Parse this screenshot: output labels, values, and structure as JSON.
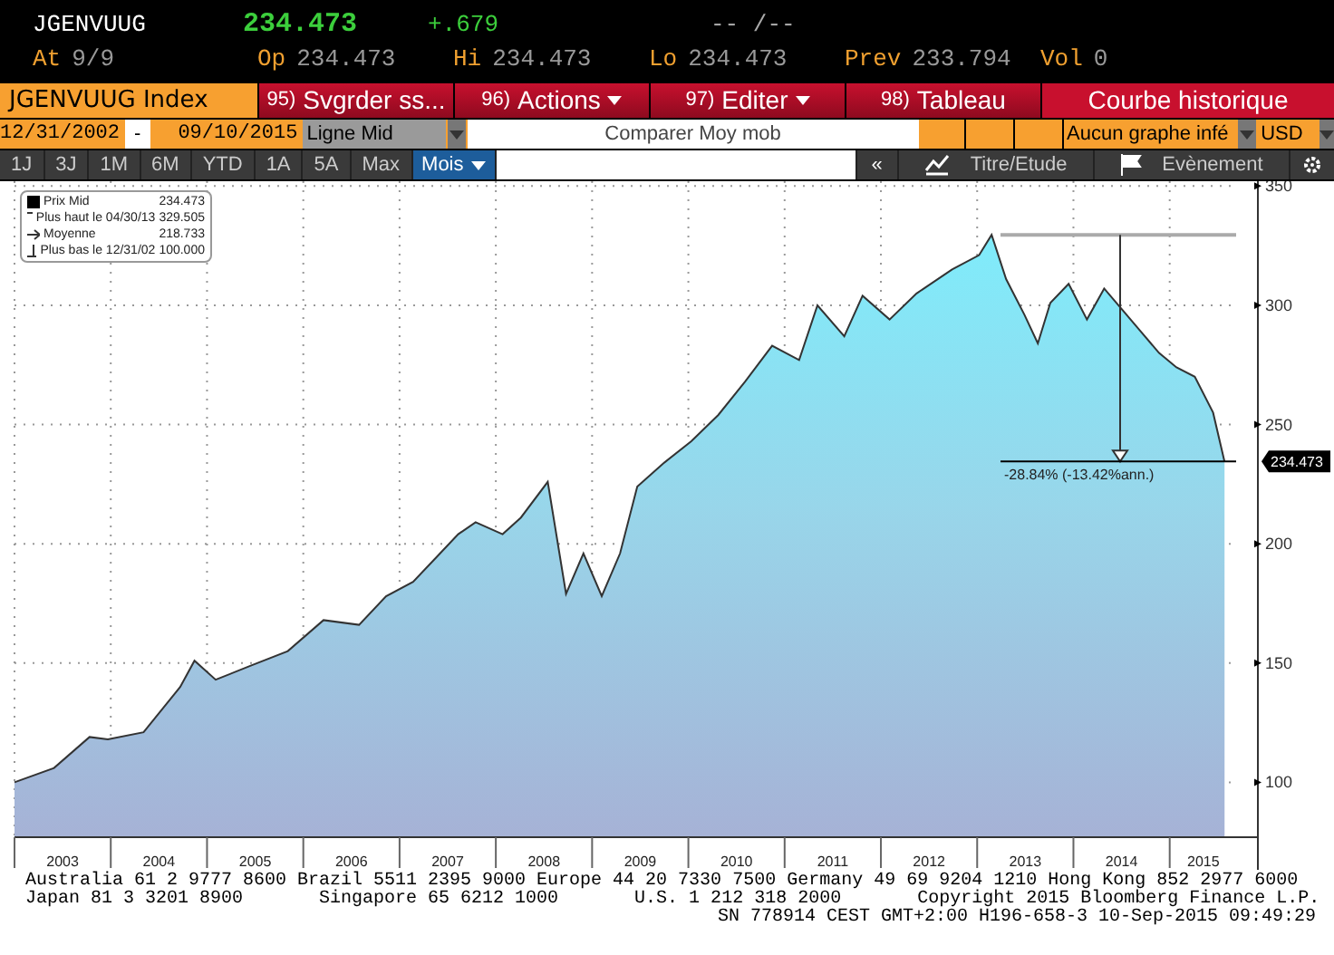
{
  "quote": {
    "ticker": "JGENVUUG",
    "last": "234.473",
    "change": "+.679",
    "time_range": "-- /--"
  },
  "stats": [
    {
      "label": "At",
      "value": "9/9"
    },
    {
      "label": "Op",
      "value": "234.473"
    },
    {
      "label": "Hi",
      "value": "234.473"
    },
    {
      "label": "Lo",
      "value": "234.473"
    },
    {
      "label": "Prev",
      "value": "233.794"
    },
    {
      "label": "Vol",
      "value": "0"
    }
  ],
  "toolbar": {
    "security": "JGENVUUG Index",
    "menus": [
      {
        "number": "95)",
        "label": "Svgrder ss...",
        "dropdown": false
      },
      {
        "number": "96)",
        "label": "Actions",
        "dropdown": true
      },
      {
        "number": "97)",
        "label": "Editer",
        "dropdown": true
      },
      {
        "number": "98)",
        "label": "Tableau",
        "dropdown": false
      }
    ],
    "title": "Courbe historique"
  },
  "range": {
    "start": "12/31/2002",
    "separator": "-",
    "end": "09/10/2015",
    "line_type": "Ligne Mid",
    "compare": "Comparer Moy mob",
    "lower_chart": "Aucun graphe infé",
    "currency": "USD"
  },
  "periods": [
    {
      "label": "1J",
      "selected": false,
      "dropdown": false
    },
    {
      "label": "3J",
      "selected": false,
      "dropdown": false
    },
    {
      "label": "1M",
      "selected": false,
      "dropdown": false
    },
    {
      "label": "6M",
      "selected": false,
      "dropdown": false
    },
    {
      "label": "YTD",
      "selected": false,
      "dropdown": false
    },
    {
      "label": "1A",
      "selected": false,
      "dropdown": false
    },
    {
      "label": "5A",
      "selected": false,
      "dropdown": false
    },
    {
      "label": "Max",
      "selected": false,
      "dropdown": false
    },
    {
      "label": "Mois",
      "selected": true,
      "dropdown": true
    }
  ],
  "tools": [
    {
      "kind": "collapse",
      "label": "«"
    },
    {
      "kind": "chart",
      "label": "Titre/Etude"
    },
    {
      "kind": "flag",
      "label": "Evènement"
    },
    {
      "kind": "settings"
    }
  ],
  "legend": [
    {
      "kind": "price",
      "value": "234.473"
    },
    {
      "kind": "high",
      "label": "Plus haut le 04/30/13",
      "value": "329.505"
    },
    {
      "kind": "average",
      "label": "Moyenne",
      "value": "218.733"
    },
    {
      "kind": "low",
      "label": "Plus bas le 12/31/02",
      "value": "100.000"
    }
  ],
  "chart_data": {
    "type": "area",
    "grid": true,
    "xlim": [
      2003,
      2015.69
    ],
    "ylim": [
      77,
      352
    ],
    "xticks": [
      {
        "value": 2003.5,
        "label": "2003"
      },
      {
        "value": 2004.5,
        "label": "2004"
      },
      {
        "value": 2005.5,
        "label": "2005"
      },
      {
        "value": 2006.5,
        "label": "2006"
      },
      {
        "value": 2007.5,
        "label": "2007"
      },
      {
        "value": 2008.5,
        "label": "2008"
      },
      {
        "value": 2009.5,
        "label": "2009"
      },
      {
        "value": 2010.5,
        "label": "2010"
      },
      {
        "value": 2011.5,
        "label": "2011"
      },
      {
        "value": 2012.5,
        "label": "2012"
      },
      {
        "value": 2013.5,
        "label": "2013"
      },
      {
        "value": 2014.5,
        "label": "2014"
      },
      {
        "value": 2015.35,
        "label": "2015"
      }
    ],
    "yticks": [
      100,
      150,
      200,
      250,
      300,
      350
    ],
    "x": [
      2003.0,
      2003.41,
      2003.78,
      2003.97,
      2004.34,
      2004.72,
      2004.87,
      2005.09,
      2005.46,
      2005.84,
      2006.21,
      2006.58,
      2006.86,
      2007.14,
      2007.42,
      2007.61,
      2007.79,
      2008.07,
      2008.26,
      2008.54,
      2008.73,
      2008.91,
      2009.1,
      2009.29,
      2009.47,
      2009.75,
      2010.03,
      2010.31,
      2010.59,
      2010.87,
      2011.15,
      2011.34,
      2011.62,
      2011.81,
      2012.09,
      2012.37,
      2012.74,
      2013.02,
      2013.15,
      2013.3,
      2013.49,
      2013.63,
      2013.76,
      2013.95,
      2014.14,
      2014.32,
      2014.51,
      2014.7,
      2014.89,
      2015.07,
      2015.26,
      2015.45,
      2015.57
    ],
    "series": [
      {
        "name": "Prix Mid",
        "color": "#333333",
        "values": [
          100,
          106,
          119,
          118,
          121,
          140,
          151,
          143,
          149,
          155,
          168,
          166,
          178,
          184,
          196,
          204,
          209,
          204,
          211,
          226,
          179,
          196,
          178,
          196,
          224,
          234,
          243,
          254,
          268,
          283,
          277,
          300,
          287,
          304,
          294,
          305,
          315,
          321,
          329.5,
          311,
          296,
          284,
          301,
          309,
          294,
          307,
          298,
          289,
          280,
          274,
          270,
          255,
          234.5
        ]
      }
    ],
    "annotations": [
      "-28.84% (-13.42%ann.)",
      "234.473"
    ]
  },
  "footer": [
    "Australia 61 2 9777 8600 Brazil 5511 2395 9000 Europe 44 20 7330 7500 Germany 49 69 9204 1210 Hong Kong 852 2977 6000",
    "Japan 81 3 3201 8900       Singapore 65 6212 1000       U.S. 1 212 318 2000       Copyright 2015 Bloomberg Finance L.P.",
    "SN 778914 CEST GMT+2:00 H196-658-3 10-Sep-2015 09:49:29"
  ]
}
